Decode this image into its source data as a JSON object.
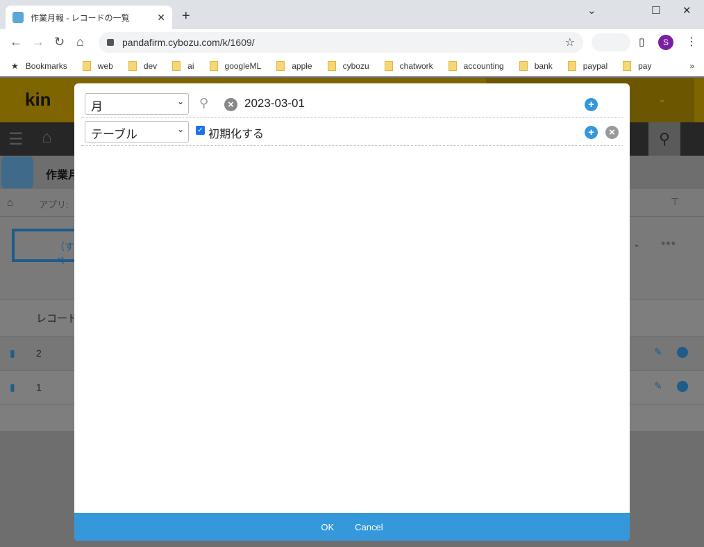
{
  "browser": {
    "tab_title": "作業月報 - レコードの一覧",
    "url": "pandafirm.cybozu.com/k/1609/",
    "profile_initial": "S",
    "bookmarks_label": "Bookmarks",
    "bookmarks": [
      "web",
      "dev",
      "ai",
      "googleML",
      "apple",
      "cybozu",
      "chatwork",
      "accounting",
      "bank",
      "paypal",
      "pay"
    ]
  },
  "page": {
    "logo": "kin",
    "app_title": "作業月",
    "breadcrumb": "アプリ: ",
    "view_label": "（すべ",
    "table_header": "レコード",
    "rows": [
      "2",
      "1"
    ]
  },
  "dialog": {
    "row1": {
      "select": "月",
      "value": "2023-03-01"
    },
    "row2": {
      "select": "テーブル",
      "checkbox_label": "初期化する",
      "checked": true
    },
    "ok": "OK",
    "cancel": "Cancel"
  },
  "colors": {
    "accent": "#3498db",
    "header": "#b48f00"
  }
}
